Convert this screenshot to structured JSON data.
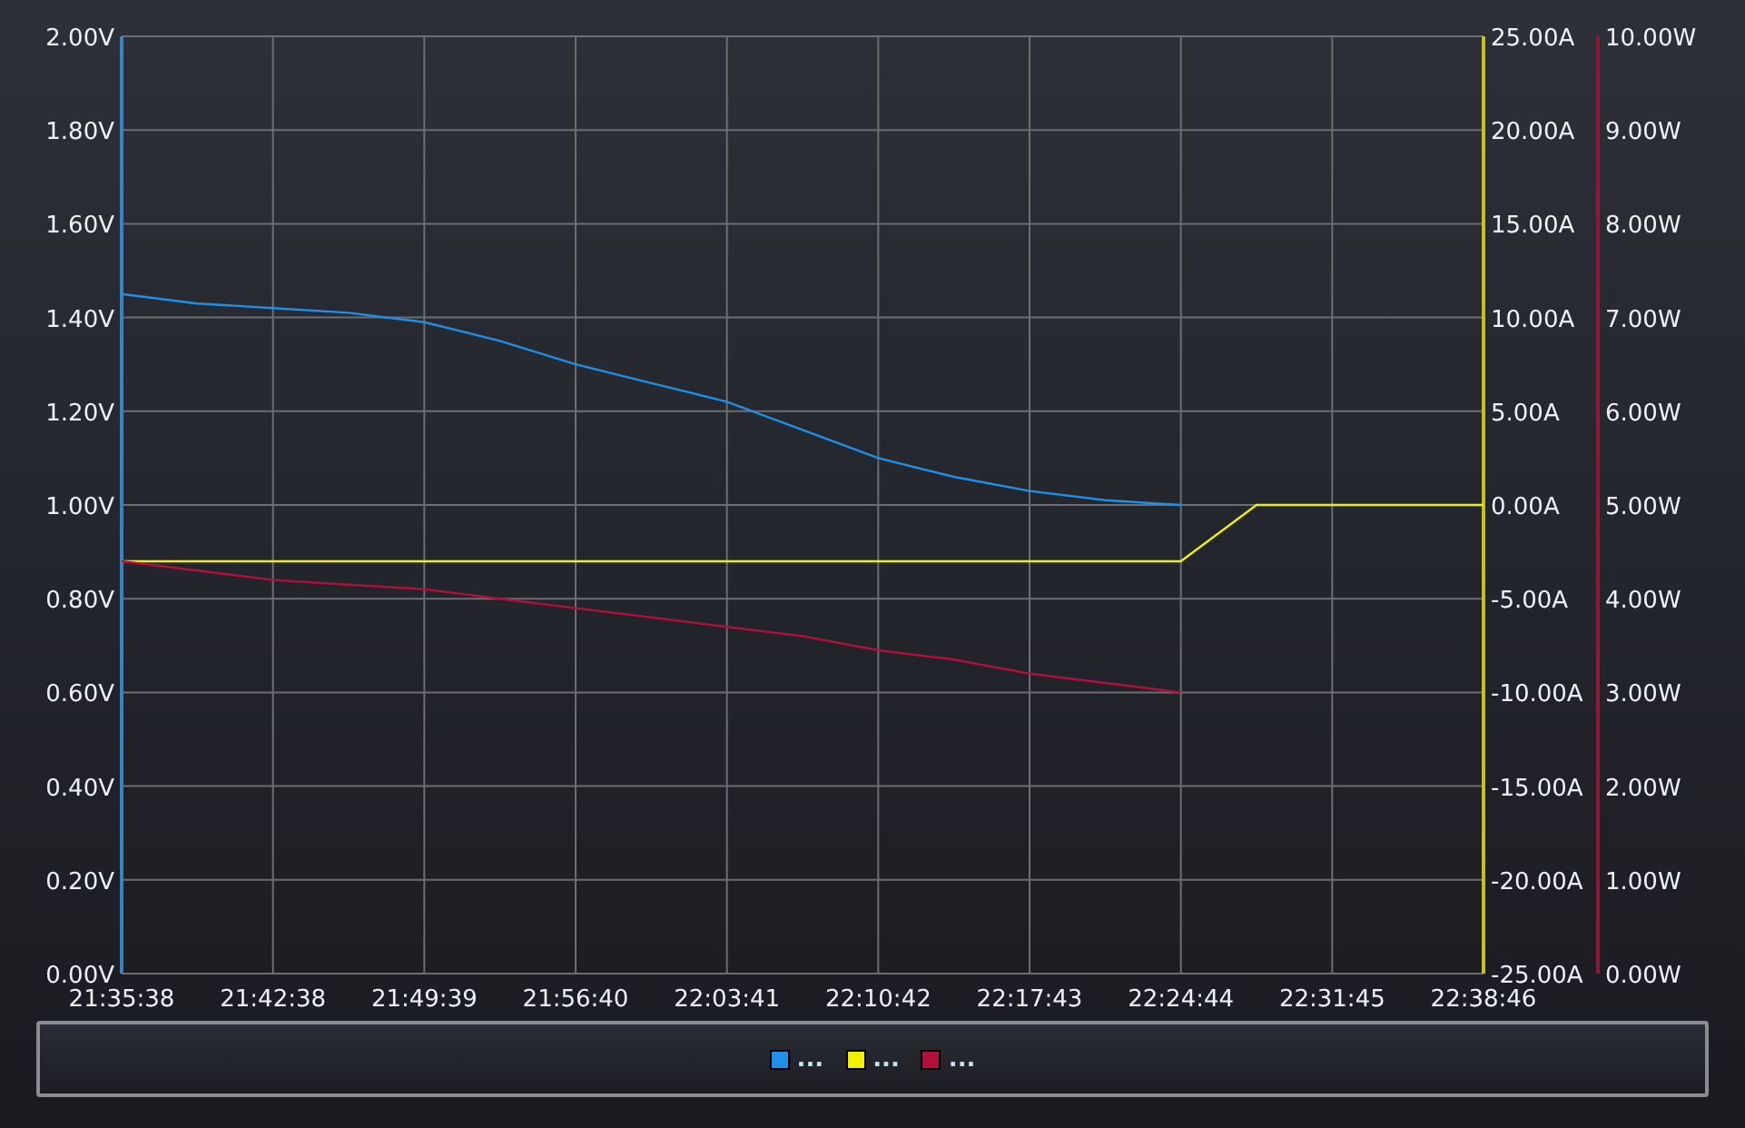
{
  "chart": {
    "chart_data": {
      "type": "line",
      "grid": true,
      "categories": [
        "21:35:38",
        null,
        "21:42:38",
        null,
        "21:49:39",
        null,
        "21:56:40",
        null,
        "22:03:41",
        null,
        "22:10:42",
        null,
        "22:17:43",
        null,
        "22:24:44",
        null,
        "22:31:45",
        null,
        "22:38:46"
      ],
      "ylim": [
        0,
        2
      ],
      "yticks": [
        {
          "value": 0,
          "label": "0.00V"
        },
        {
          "value": 0.2,
          "label": "0.20V"
        },
        {
          "value": 0.4,
          "label": "0.40V"
        },
        {
          "value": 0.6,
          "label": "0.60V"
        },
        {
          "value": 0.8,
          "label": "0.80V"
        },
        {
          "value": 1,
          "label": "1.00V"
        },
        {
          "value": 1.2,
          "label": "1.20V"
        },
        {
          "value": 1.4,
          "label": "1.40V"
        },
        {
          "value": 1.6,
          "label": "1.60V"
        },
        {
          "value": 1.8,
          "label": "1.80V"
        },
        {
          "value": 2,
          "label": "2.00V"
        }
      ],
      "y2lim": [
        -25,
        25
      ],
      "y2ticks": [
        {
          "value": -25,
          "label": "-25.00A"
        },
        {
          "value": -20,
          "label": "-20.00A"
        },
        {
          "value": -15,
          "label": "-15.00A"
        },
        {
          "value": -10,
          "label": "-10.00A"
        },
        {
          "value": -5,
          "label": "-5.00A"
        },
        {
          "value": 0,
          "label": "0.00A"
        },
        {
          "value": 5,
          "label": "5.00A"
        },
        {
          "value": 10,
          "label": "10.00A"
        },
        {
          "value": 15,
          "label": "15.00A"
        },
        {
          "value": 20,
          "label": "20.00A"
        },
        {
          "value": 25,
          "label": "25.00A"
        }
      ],
      "y3lim": [
        0,
        10
      ],
      "y3ticks": [
        {
          "value": 0,
          "label": "0.00W"
        },
        {
          "value": 1,
          "label": "1.00W"
        },
        {
          "value": 2,
          "label": "2.00W"
        },
        {
          "value": 3,
          "label": "3.00W"
        },
        {
          "value": 4,
          "label": "4.00W"
        },
        {
          "value": 5,
          "label": "5.00W"
        },
        {
          "value": 6,
          "label": "6.00W"
        },
        {
          "value": 7,
          "label": "7.00W"
        },
        {
          "value": 8,
          "label": "8.00W"
        },
        {
          "value": 9,
          "label": "9.00W"
        },
        {
          "value": 10,
          "label": "10.00W"
        }
      ],
      "series": [
        {
          "name": "...",
          "color": "#1e90e8",
          "values": [
            1.45,
            1.43,
            1.42,
            1.41,
            1.39,
            1.35,
            1.3,
            1.26,
            1.22,
            1.16,
            1.1,
            1.06,
            1.03,
            1.01,
            1.0,
            null,
            null,
            null,
            null
          ]
        },
        {
          "name": "...",
          "color": "#f0f000",
          "axis": "y2",
          "values": [
            -3.0,
            -3.0,
            -3.0,
            -3.0,
            -3.0,
            -3.0,
            -3.0,
            -3.0,
            -3.0,
            -3.0,
            -3.0,
            -3.0,
            -3.0,
            -3.0,
            -3.0,
            0,
            0,
            0,
            0
          ]
        },
        {
          "name": "...",
          "color": "#b0103a",
          "axis": "y3",
          "values": [
            4.4,
            4.3,
            4.2,
            4.15,
            4.1,
            4.0,
            3.9,
            3.8,
            3.7,
            3.6,
            3.45,
            3.35,
            3.2,
            3.1,
            3.0,
            null,
            null,
            null,
            null
          ]
        }
      ]
    }
  }
}
